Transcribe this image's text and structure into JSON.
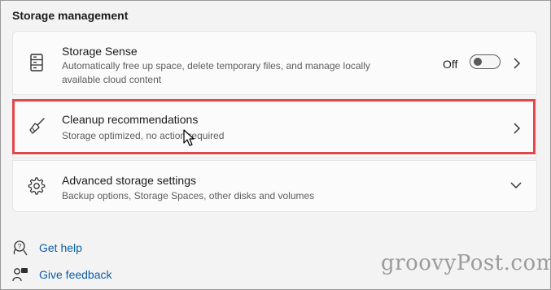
{
  "section_title": "Storage management",
  "items": [
    {
      "title": "Storage Sense",
      "description": "Automatically free up space, delete temporary files, and manage locally available cloud content",
      "icon": "drive-icon",
      "toggle_label": "Off",
      "toggle_state": "off"
    },
    {
      "title": "Cleanup recommendations",
      "description": "Storage optimized, no action required",
      "icon": "broom-icon"
    },
    {
      "title": "Advanced storage settings",
      "description": "Backup options, Storage Spaces, other disks and volumes",
      "icon": "gear-icon"
    }
  ],
  "links": [
    {
      "label": "Get help",
      "icon": "help-icon"
    },
    {
      "label": "Give feedback",
      "icon": "feedback-icon"
    }
  ],
  "watermark": "groovyPost.com",
  "colors": {
    "highlight": "#e2474b",
    "link": "#0c5da8"
  }
}
